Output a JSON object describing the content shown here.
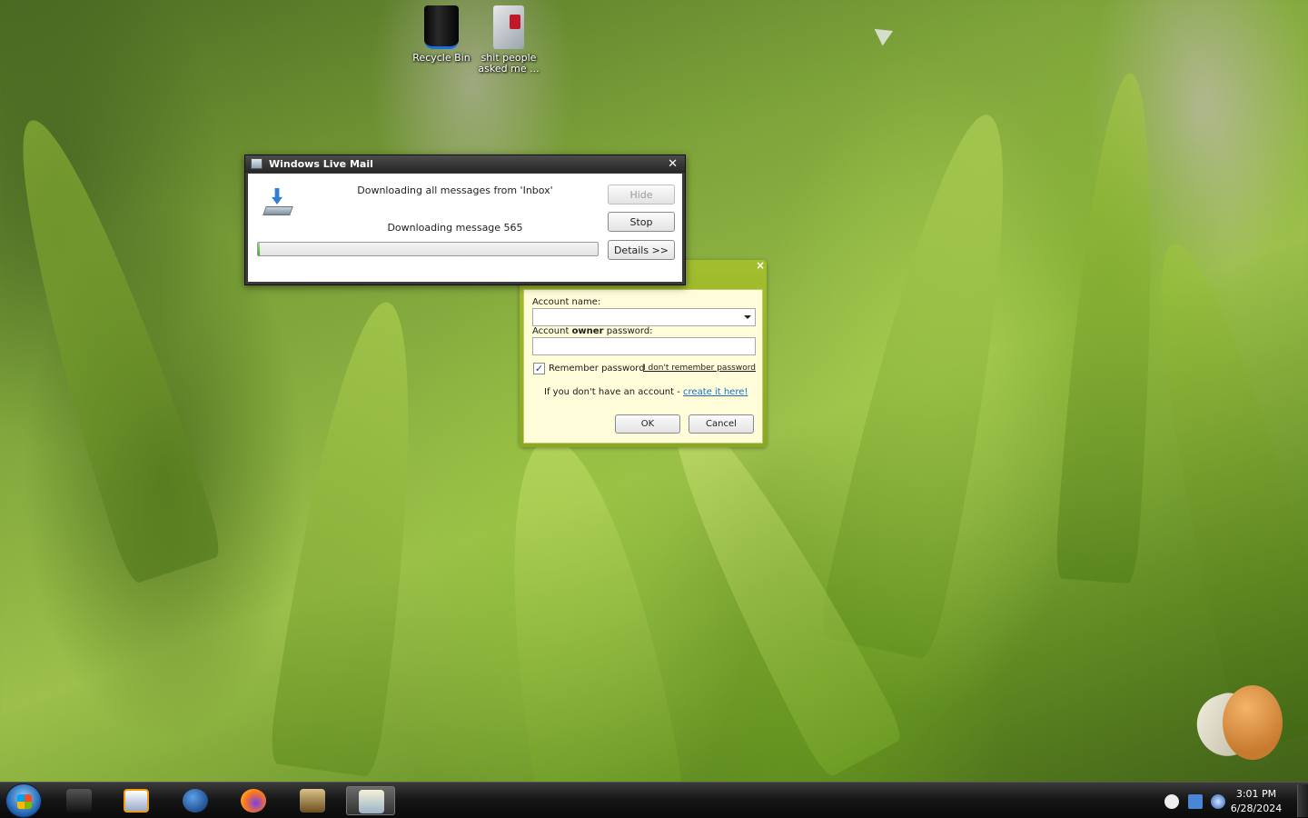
{
  "desktop": {
    "icons": [
      {
        "label": "Recycle Bin"
      },
      {
        "label": "shit people asked me ..."
      }
    ]
  },
  "download_window": {
    "title": "Windows Live Mail",
    "status_line": "Downloading all messages from 'Inbox'",
    "progress_line": "Downloading message 565",
    "progress_fraction": 0.005,
    "buttons": {
      "hide": "Hide",
      "stop": "Stop",
      "details": "Details >>"
    }
  },
  "signin_panel": {
    "account_name_label": "Account name:",
    "account_name_value": "",
    "password_label_prefix": "Account ",
    "password_label_bold": "owner",
    "password_label_suffix": " password:",
    "password_value": "",
    "remember_label": "Remember password",
    "remember_checked": true,
    "forgot_link": "I don't remember password",
    "no_account_text": "If you don't have an account - ",
    "create_link": "create it here!",
    "ok_label": "OK",
    "cancel_label": "Cancel"
  },
  "taskbar": {
    "clock_time": "3:01 PM",
    "clock_date": "6/28/2024"
  }
}
